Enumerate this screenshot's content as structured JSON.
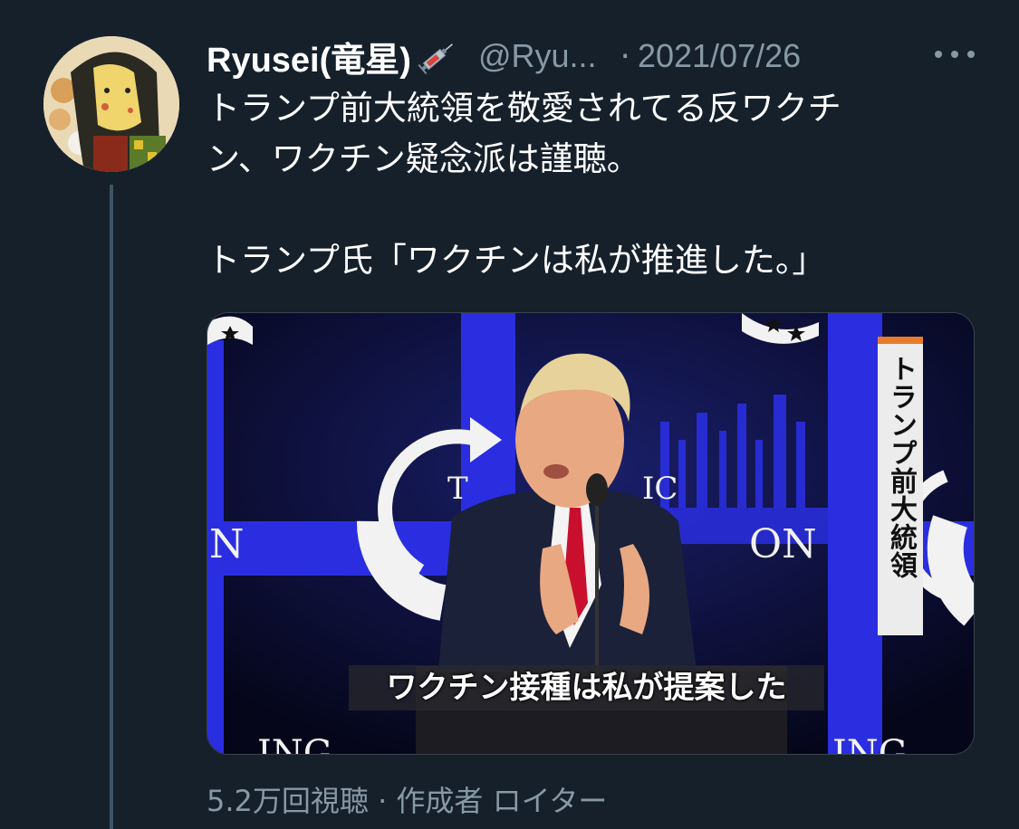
{
  "tweet": {
    "display_name": "Ryusei(竜星)",
    "name_emoji": "syringe-icon",
    "handle": "@Ryu...",
    "separator": "·",
    "date": "2021/07/26",
    "more_icon": "more-icon",
    "text_lines": [
      "トランプ前大統領を敬愛されてる反ワクチ",
      "ン、ワクチン疑念派は謹聴。",
      "トランプ氏「ワクチンは私が推進した。」"
    ]
  },
  "video": {
    "caption": "ワクチン接種は私が提案した",
    "side_label": "トランプ前大統領",
    "backdrop_text_left": "N",
    "backdrop_text_right": "ON",
    "backdrop_text_center": "T",
    "backdrop_text_center2": "IC",
    "bottom_text_left": "ING",
    "bottom_text_right": "ING"
  },
  "footer": {
    "views": "5.2万回視聴",
    "separator": "·",
    "source": "作成者 ロイター"
  },
  "colors": {
    "background": "#15202b",
    "secondary_text": "#8899a6",
    "stage_blue": "#2a2ee0",
    "tie_red": "#c8102e",
    "label_accent": "#e87b2a"
  }
}
